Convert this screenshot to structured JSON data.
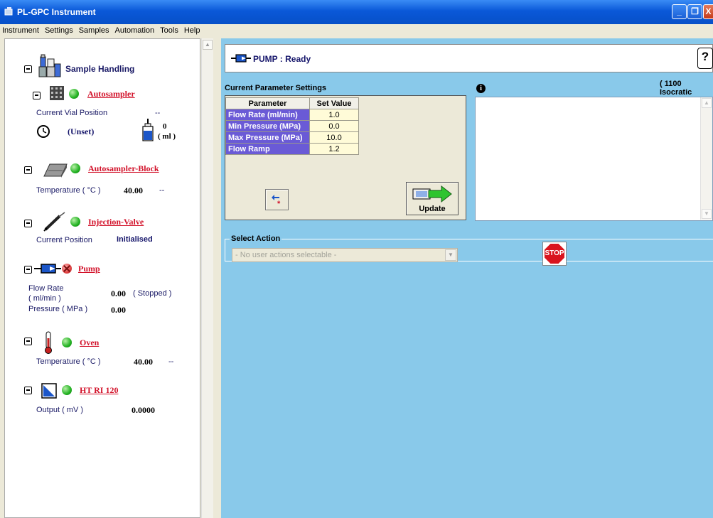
{
  "window": {
    "title": "PL-GPC Instrument"
  },
  "menu": [
    "Instrument",
    "Settings",
    "Samples",
    "Automation",
    "Tools",
    "Help"
  ],
  "sidebar": {
    "section_title": "Sample Handling",
    "autosampler": {
      "name": "Autosampler",
      "vial_label": "Current Vial Position",
      "vial_value": "--",
      "time_value": "(Unset)",
      "volume_value": "0",
      "volume_unit": "( ml )"
    },
    "block": {
      "name": "Autosampler-Block",
      "temp_label": "Temperature ( °C )",
      "temp_value": "40.00",
      "temp_extra": "--"
    },
    "valve": {
      "name": "Injection-Valve",
      "pos_label": "Current Position",
      "pos_value": "Initialised"
    },
    "pump": {
      "name": "Pump",
      "flow_label_1": "Flow Rate",
      "flow_label_2": "( ml/min )",
      "flow_value": "0.00",
      "flow_state": "( Stopped )",
      "pressure_label": "Pressure ( MPa )",
      "pressure_value": "0.00"
    },
    "oven": {
      "name": "Oven",
      "temp_label": "Temperature ( °C )",
      "temp_value": "40.00",
      "temp_extra": "--"
    },
    "detector": {
      "name": "HT RI 120",
      "output_label": "Output ( mV )",
      "output_value": "0.0000"
    }
  },
  "status": {
    "text": "PUMP : Ready",
    "model_note": "( 1100 Isocratic"
  },
  "params": {
    "title": "Current Parameter Settings",
    "headers": [
      "Parameter",
      "Set Value"
    ],
    "rows": [
      {
        "name": "Flow Rate (ml/min)",
        "value": "1.0"
      },
      {
        "name": "Min Pressure (MPa)",
        "value": "0.0"
      },
      {
        "name": "Max Pressure (MPa)",
        "value": "10.0"
      },
      {
        "name": "Flow Ramp",
        "value": "1.2"
      }
    ],
    "update_label": "Update"
  },
  "info": {
    "icon": "i"
  },
  "help": {
    "label": "?"
  },
  "select_action": {
    "title": "Select Action",
    "value": "- No user actions selectable -",
    "stop_label": "STOP"
  },
  "colors": {
    "panel_bg": "#89c9ea",
    "param_name_bg": "#6a5ad6",
    "param_value_bg": "#fffbd8",
    "link": "#d2122a",
    "led_ok": "#22b222",
    "led_err": "#e24444"
  }
}
